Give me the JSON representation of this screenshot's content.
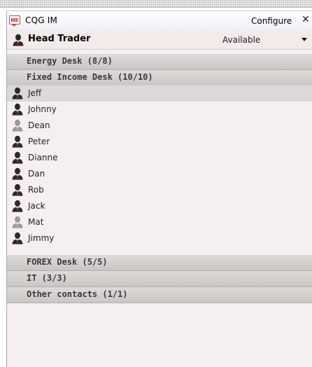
{
  "window": {
    "title": "CQG IM",
    "configure_label": "Configure",
    "close_symbol": "✕"
  },
  "user": {
    "name": "Head Trader",
    "status": "Available"
  },
  "groups": [
    {
      "label": "Energy Desk (8/8)",
      "expanded": false
    },
    {
      "label": "Fixed Income Desk (10/10)",
      "expanded": true
    },
    {
      "label": "FOREX Desk (5/5)",
      "expanded": false
    },
    {
      "label": "IT (3/3)",
      "expanded": false
    },
    {
      "label": "Other contacts (1/1)",
      "expanded": false
    }
  ],
  "contacts": [
    {
      "name": "Jeff",
      "online": true,
      "selected": true
    },
    {
      "name": "Johnny",
      "online": true
    },
    {
      "name": "Dean",
      "online": false
    },
    {
      "name": "Peter",
      "online": true
    },
    {
      "name": "Dianne",
      "online": true
    },
    {
      "name": "Dan",
      "online": true
    },
    {
      "name": "Rob",
      "online": true
    },
    {
      "name": "Jack",
      "online": true
    },
    {
      "name": "Mat",
      "online": false
    },
    {
      "name": "Jimmy",
      "online": true
    }
  ],
  "colors": {
    "panel_bg": "#f6efef",
    "group_header_bg": "#d4d0ce",
    "selected_row_bg": "#dbd9d9",
    "expander_arrow": "#b9d3ee",
    "online_icon": "#2b2b2b",
    "offline_icon": "#9a9a9a",
    "tie_red": "#d21f1f",
    "app_icon_red": "#e0262c"
  },
  "icons": {
    "app": "cqg-speech-bubble-icon",
    "user": "trader-person-icon",
    "expand": "triangle-right-icon",
    "collapse": "triangle-down-icon"
  }
}
